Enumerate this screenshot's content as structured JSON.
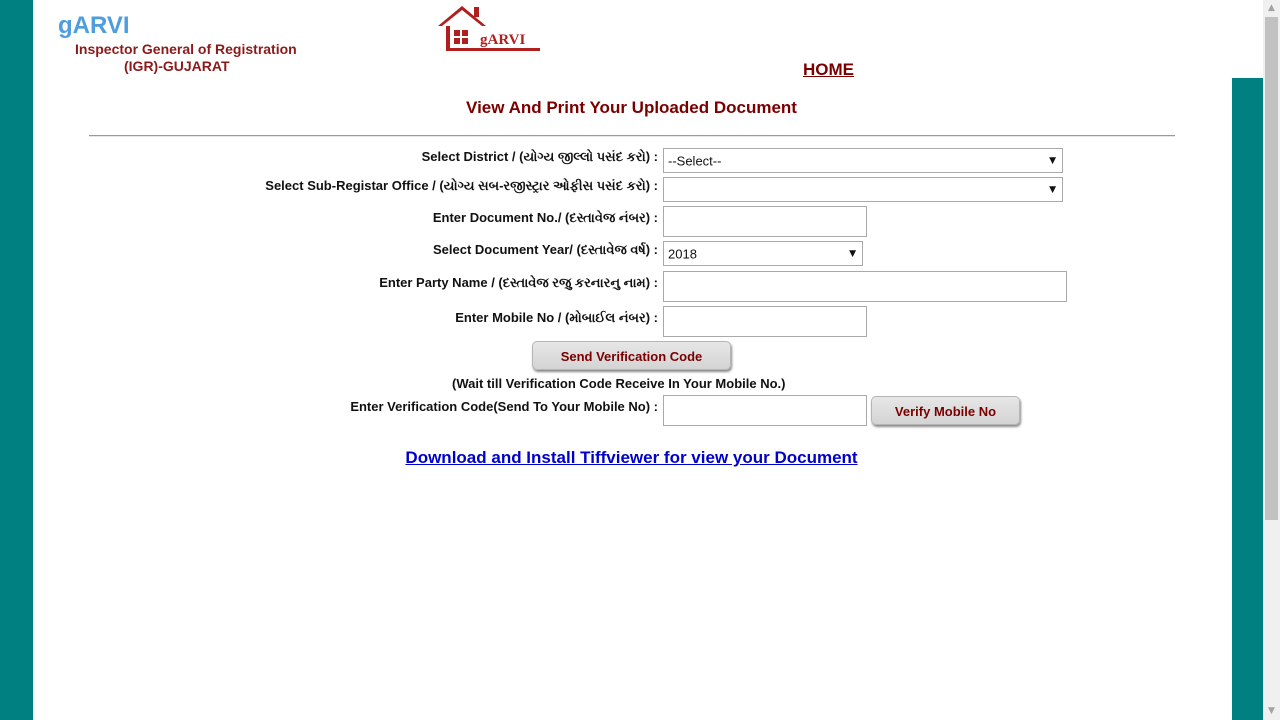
{
  "header": {
    "brand": "gARVI",
    "org_line1": "Inspector General of Registration",
    "org_line2": "(IGR)-GUJARAT",
    "logo_text": "gARVI",
    "home_link": "HOME"
  },
  "page_title": "View And Print Your Uploaded Document",
  "form": {
    "district_label": "Select District / (યોગ્ય જીલ્લો પસંદ કરો) :",
    "district_value": "--Select--",
    "subregistrar_label": "Select Sub-Registar Office / (યોગ્ય સબ-રજીસ્ટ્રાર ઓફીસ પસંદ કરો) :",
    "subregistrar_value": "",
    "docno_label": "Enter Document No./ (દસ્તાવેજ નંબર) :",
    "docno_value": "",
    "year_label": "Select Document Year/ (દસ્તાવેજ વર્ષ) :",
    "year_value": "2018",
    "party_label": "Enter Party Name / (દસ્તાવેજ રજુ કરનારનુ નામ) :",
    "party_value": "",
    "mobile_label": "Enter Mobile No / (મોબાઈલ નંબર) :",
    "mobile_value": "",
    "send_code_button": "Send Verification Code",
    "wait_note": "(Wait till Verification Code Receive In Your Mobile No.)",
    "verify_label": "Enter Verification Code(Send To Your Mobile No) :",
    "verify_value": "",
    "verify_button": "Verify Mobile No"
  },
  "download_link": "Download and Install Tiffviewer for view your Document",
  "colors": {
    "teal_background": "#008080",
    "heading_maroon": "#7a0000",
    "brand_blue": "#4d9de0",
    "link_blue": "#0000cc"
  }
}
